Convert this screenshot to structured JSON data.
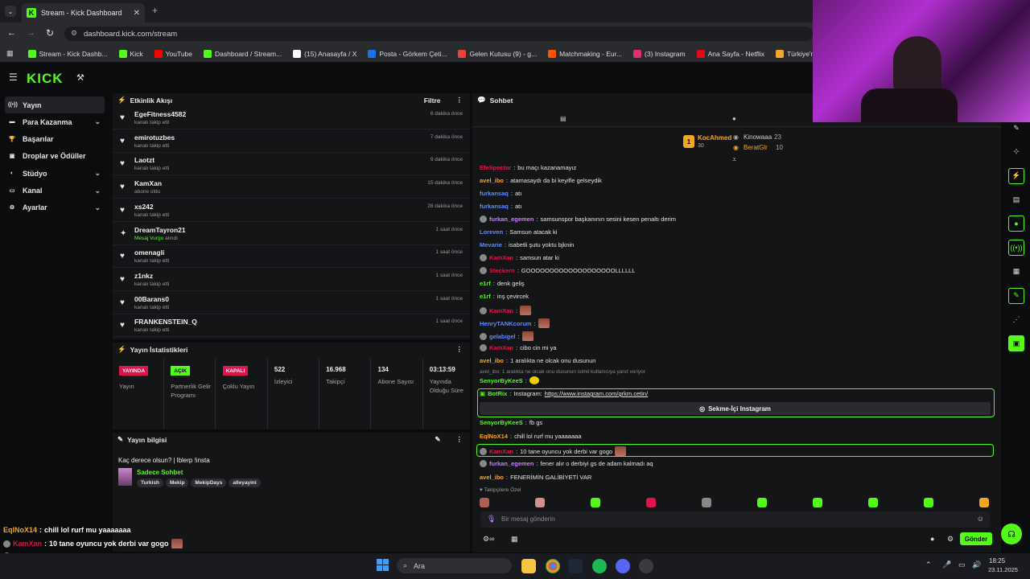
{
  "browser": {
    "tab_title": "Stream - Kick Dashboard",
    "url": "dashboard.kick.com/stream",
    "bookmarks": [
      {
        "label": "Stream - Kick Dashb...",
        "color": "#53fc18"
      },
      {
        "label": "Kick",
        "color": "#53fc18"
      },
      {
        "label": "YouTube",
        "color": "#ff0000"
      },
      {
        "label": "Dashboard / Stream...",
        "color": "#53fc18"
      },
      {
        "label": "(15) Anasayfa / X",
        "color": "#ffffff"
      },
      {
        "label": "Posta - Görkem Çeti...",
        "color": "#1a73e8"
      },
      {
        "label": "Gelen Kutusu (9) - g...",
        "color": "#ea4335"
      },
      {
        "label": "Matchmaking - Eur...",
        "color": "#ff5500"
      },
      {
        "label": "(3) Instagram",
        "color": "#e1306c"
      },
      {
        "label": "Ana Sayfa - Netflix",
        "color": "#e50914"
      },
      {
        "label": "Türkiye'nin En Büyü...",
        "color": "#f5a623"
      }
    ]
  },
  "sidebar": {
    "items": [
      {
        "label": "Yayın",
        "icon": "broadcast-icon",
        "active": true,
        "chevron": false
      },
      {
        "label": "Para Kazanma",
        "icon": "money-icon",
        "active": false,
        "chevron": true
      },
      {
        "label": "Başarılar",
        "icon": "trophy-icon",
        "active": false,
        "chevron": false
      },
      {
        "label": "Droplar ve Ödüller",
        "icon": "gift-icon",
        "active": false,
        "chevron": false
      },
      {
        "label": "Stüdyo",
        "icon": "studio-icon",
        "active": false,
        "chevron": true
      },
      {
        "label": "Kanal",
        "icon": "channel-icon",
        "active": false,
        "chevron": true
      },
      {
        "label": "Ayarlar",
        "icon": "gear-icon",
        "active": false,
        "chevron": true
      }
    ]
  },
  "activity": {
    "title": "Etkinlik Akışı",
    "filter": "Filtre",
    "rows": [
      {
        "name": "EgeFitness4582",
        "sub": "kanalı takip etti",
        "time": "6 dakika önce",
        "icon": "heart-icon"
      },
      {
        "name": "emirotuzbes",
        "sub": "kanalı takip etti",
        "time": "7 dakika önce",
        "icon": "heart-icon"
      },
      {
        "name": "Laotzt",
        "sub": "kanalı takip etti",
        "time": "9 dakika önce",
        "icon": "heart-icon"
      },
      {
        "name": "KamXan",
        "sub": "abone oldu",
        "time": "15 dakika önce",
        "icon": "star-icon"
      },
      {
        "name": "xs242",
        "sub": "kanalı takip etti",
        "time": "28 dakika önce",
        "icon": "heart-icon"
      },
      {
        "name": "DreamTayron21",
        "sub_highlight": "Mesaj Vurgu",
        "sub": "alındı",
        "time": "1 saat önce",
        "icon": "highlight-icon"
      },
      {
        "name": "omenagli",
        "sub": "kanalı takip etti",
        "time": "1 saat önce",
        "icon": "heart-icon"
      },
      {
        "name": "z1nkz",
        "sub": "kanalı takip etti",
        "time": "1 saat önce",
        "icon": "heart-icon"
      },
      {
        "name": "00Barans0",
        "sub": "kanalı takip etti",
        "time": "1 saat önce",
        "icon": "heart-icon"
      },
      {
        "name": "FRANKENSTEIN_Q",
        "sub": "kanalı takip etti",
        "time": "1 saat önce",
        "icon": "heart-icon"
      }
    ]
  },
  "stats": {
    "title": "Yayın İstatistikleri",
    "items": [
      {
        "badge": "YAYINDA",
        "badge_color": "#e0144c",
        "label": "Yayın"
      },
      {
        "badge": "AÇIK",
        "badge_color": "#53fc18",
        "label": "Partnerlik Gelir Programı"
      },
      {
        "badge": "KAPALI",
        "badge_color": "#e0144c",
        "label": "Çoklu Yayın"
      },
      {
        "value": "522",
        "label": "İzleyici"
      },
      {
        "value": "16.968",
        "label": "Takipçi"
      },
      {
        "value": "134",
        "label": "Abone Sayısı"
      },
      {
        "value": "03:13:59",
        "label": "Yayında Olduğu Süre"
      }
    ]
  },
  "stream_info": {
    "title": "Yayın bilgisi",
    "stream_title": "Kaç derece olsun? | lblerp !insta",
    "category": "Sadece Sohbet",
    "tags": [
      "Turkish",
      "Mekip",
      "MekipDays",
      "alleyayini"
    ]
  },
  "chat": {
    "title": "Sohbet",
    "top_user": {
      "name": "KocAhmed",
      "count": "30",
      "rank": "1"
    },
    "leaders": [
      {
        "name": "Kinowaaa",
        "count": "23"
      },
      {
        "name": "BeratGlr",
        "count": "10"
      }
    ],
    "messages": [
      {
        "user": "EfeSpectar",
        "color": "#e0144c",
        "text": "bu maçı kazanamayız"
      },
      {
        "user": "avel_ibo",
        "color": "#f5a623",
        "text": "atamasaydı da bi keyifle gelseydik"
      },
      {
        "user": "furkansaq",
        "color": "#5b8cff",
        "text": "atı"
      },
      {
        "user": "furkansaq",
        "color": "#5b8cff",
        "text": "atı"
      },
      {
        "user": "furkan_egemen",
        "color": "#c084fc",
        "text": "samsunspor başkanının sesini kesen penaltı derim"
      },
      {
        "user": "Loreven",
        "color": "#5b8cff",
        "text": "Samsun atacak ki"
      },
      {
        "user": "Mevarie",
        "color": "#5b8cff",
        "text": "isabetli şutu yoktu bjknin"
      },
      {
        "user": "KamXan",
        "color": "#e0144c",
        "text": "samsun atar ki"
      },
      {
        "user": "Steckern",
        "color": "#e0144c",
        "text": "GOOOOOOOOOOOOOOOOOOOLLLLLL"
      },
      {
        "user": "e1rf",
        "color": "#53fc18",
        "text": "denk geliş"
      },
      {
        "user": "e1rf",
        "color": "#53fc18",
        "text": "inş çevircek"
      },
      {
        "user": "KamXan",
        "color": "#e0144c",
        "text": ""
      },
      {
        "user": "HenryTANKcorum",
        "color": "#5b8cff",
        "text": ""
      },
      {
        "user": "gelabigel",
        "color": "#5b8cff",
        "text": ""
      },
      {
        "user": "KamXan",
        "color": "#e0144c",
        "text": "cibo cin mi ya"
      },
      {
        "user": "avel_ibo",
        "color": "#f5a623",
        "text": "1 aralıkta ne olcak onu dusunun"
      }
    ],
    "reply_note": "avel_ibo: 1 aralıkta ne olcak onu dusunun isimli kullanıcıya yanıt veriyor",
    "reply_user": "SenyorByKeeS",
    "bot_user": "BotRix",
    "bot_text": "Instagram:",
    "bot_link": "https://www.instagram.com/grkm.cetin/",
    "bot_button": "Sekme-İçi Instagram",
    "messages2": [
      {
        "user": "SenyorByKeeS",
        "color": "#53fc18",
        "text": "fb gs"
      },
      {
        "user": "EqlNoX14",
        "color": "#f5a623",
        "text": "chill lol rurf mu yaaaaaaa"
      },
      {
        "user": "KamXan",
        "color": "#e0144c",
        "text": "10 tane oyuncu yok derbi var gogo",
        "highlight": true
      },
      {
        "user": "furkan_egemen",
        "color": "#c084fc",
        "text": "fener alır o derbiyi gs de adam kalmadı aq"
      },
      {
        "user": "avel_ibo",
        "color": "#f5a623",
        "text": "FENERİMİN GALİBİYETİ VAR"
      }
    ],
    "followers_only": "Takipçilere Özel",
    "input_placeholder": "Bir mesaj gönderin",
    "send_label": "Gönder"
  },
  "overlay": [
    {
      "user": "EqlNoX14",
      "color": "#f5a623",
      "text": "chill lol rurf mu yaaaaaaa"
    },
    {
      "user": "KamXan",
      "color": "#e0144c",
      "text": "10 tane oyuncu yok derbi var gogo"
    },
    {
      "user": "furkan_egemen",
      "color": "#c084fc",
      "text": "fener alır o derbiyi gs de adam kalmadı aq"
    },
    {
      "user": "avel_ibo",
      "color": "#f5a623",
      "text": "FENERİMİN GALİBİYETİ VAR"
    }
  ],
  "taskbar": {
    "search": "Ara",
    "time": "18:25",
    "date": "23.11.2025"
  }
}
